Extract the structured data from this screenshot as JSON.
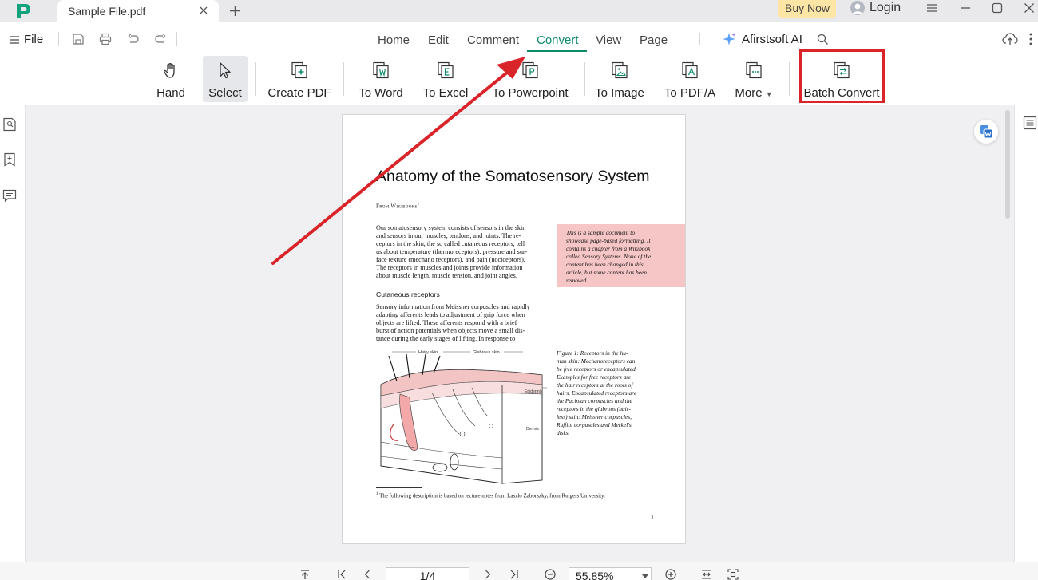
{
  "titlebar": {
    "tab_title": "Sample File.pdf",
    "buy_now": "Buy Now",
    "login": "Login",
    "brand_color": "#0e8a6b"
  },
  "menu": {
    "file": "File",
    "tabs": [
      "Home",
      "Edit",
      "Comment",
      "Convert",
      "View",
      "Page"
    ],
    "active_tab": "Convert",
    "ai": "Afirstsoft AI"
  },
  "toolbar": {
    "tools": [
      {
        "label": "Hand",
        "icon": "hand-icon"
      },
      {
        "label": "Select",
        "icon": "cursor-icon",
        "selected": true
      },
      {
        "label": "Create PDF",
        "icon": "create-pdf-icon"
      },
      {
        "label": "To Word",
        "icon": "word-icon"
      },
      {
        "label": "To Excel",
        "icon": "excel-icon"
      },
      {
        "label": "To Powerpoint",
        "icon": "powerpoint-icon"
      },
      {
        "label": "To Image",
        "icon": "image-icon"
      },
      {
        "label": "To PDF/A",
        "icon": "pdfa-icon"
      },
      {
        "label": "More",
        "icon": "more-icon"
      },
      {
        "label": "Batch Convert",
        "icon": "batch-convert-icon",
        "highlighted": true
      }
    ],
    "highlight_color": "#d9242a"
  },
  "document": {
    "title": "Anatomy of the Somatosensory System",
    "from": "From Wikibooks",
    "from_sup": "1",
    "intro_lines": [
      "Our somatosensory system consists of sensors in the skin",
      "and sensors in our muscles, tendons, and joints. The re-",
      "ceptors in the skin, the so called cutaneous receptors, tell",
      "us about temperature (thermoreceptors), pressure and sur-",
      "face texture (mechano receptors), and pain (nociceptors).",
      "The receptors in muscles and joints provide information",
      "about muscle length, muscle tension, and joint angles."
    ],
    "note_lines": [
      "This is a sample document to",
      "showcase page-based formatting. It",
      "contains a chapter from a Wikibook",
      "called Sensory Systems. None of the",
      "content has been changed in this",
      "article, but some content has been",
      "removed."
    ],
    "section": "Cutaneous receptors",
    "section_lines": [
      "Sensory information from Meissner corpuscles and rapidly",
      "adapting afferents leads to adjustment of grip force when",
      "objects are lifted. These afferents respond with a brief",
      "burst of action potentials when objects move a small dis-",
      "tance during the early stages of lifting. In response to"
    ],
    "figure_caption_lines": [
      "Figure 1:  Receptors in the hu-",
      "man skin: Mechanoreceptors can",
      "be free receptors or encapsulated.",
      "Examples for free receptors are",
      "the hair receptors at the roots of",
      "hairs. Encapsulated receptors are",
      "the Pacinian corpuscles and the",
      "receptors in the glabrous (hair-",
      "less) skin: Meissner corpuscles,",
      "Ruffini corpuscles and Merkel's",
      "disks."
    ],
    "figure_labels": {
      "hairy": "Hairy skin",
      "glabrous": "Glabrous skin",
      "epidermis": "Epidermis",
      "dermis": "Dermis"
    },
    "footnote_sup": "1",
    "footnote": "The following description is based on lecture notes from Laszlo Zaborszky, from Rutgers University.",
    "page_number": "1"
  },
  "bottombar": {
    "page": "1/4",
    "zoom": "55.85%"
  }
}
